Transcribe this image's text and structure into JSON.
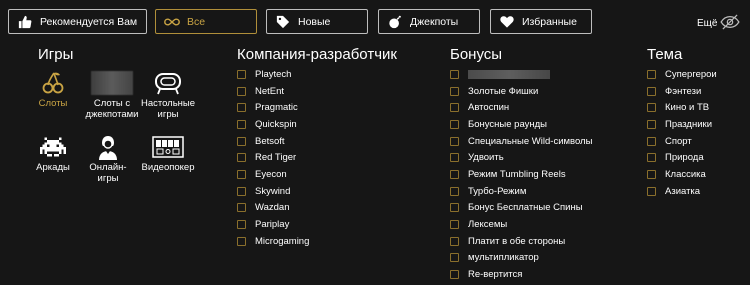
{
  "filters": [
    {
      "label": "Рекомендуется Вам",
      "icon": "thumbs-up-icon",
      "active": false
    },
    {
      "label": "Все",
      "icon": "infinity-icon",
      "active": true
    },
    {
      "label": "Новые",
      "icon": "tag-icon",
      "active": false
    },
    {
      "label": "Джекпоты",
      "icon": "bomb-icon",
      "active": false
    },
    {
      "label": "Избранные",
      "icon": "heart-icon",
      "active": false
    }
  ],
  "more": {
    "label": "Ещё",
    "icon": "eye-slash-icon"
  },
  "games": {
    "title": "Игры",
    "types": [
      {
        "label": "Слоты",
        "icon": "cherries-icon",
        "selected": true
      },
      {
        "label": "Слоты с джекпотами",
        "icon": "blurred-image",
        "selected": false
      },
      {
        "label": "Настольные игры",
        "icon": "table-icon",
        "selected": false
      },
      {
        "label": "Аркады",
        "icon": "space-invader-icon",
        "selected": false
      },
      {
        "label": "Онлайн-игры",
        "icon": "dealer-icon",
        "selected": false
      },
      {
        "label": "Видеопокер",
        "icon": "cards-icon",
        "selected": false
      }
    ]
  },
  "providers": {
    "title": "Компания-разработчик",
    "items": [
      "Playtech",
      "NetEnt",
      "Pragmatic",
      "Quickspin",
      "Betsoft",
      "Red Tiger",
      "Eyecon",
      "Skywind",
      "Wazdan",
      "Pariplay",
      "Microgaming"
    ]
  },
  "bonuses": {
    "title": "Бонусы",
    "items": [
      "",
      "Золотые Фишки",
      "Автоспин",
      "Бонусные раунды",
      "Специальные Wild-символы",
      "Удвоить",
      "Режим Tumbling Reels",
      "Турбо-Режим",
      "Бонус Бесплатные Спины",
      "Лексемы",
      "Платит в обе стороны",
      "мультипликатор",
      "Re-вертится"
    ]
  },
  "themes": {
    "title": "Тема",
    "items": [
      "Супергерои",
      "Фэнтези",
      "Кино и ТВ",
      "Праздники",
      "Спорт",
      "Природа",
      "Классика",
      "Азиатка"
    ]
  },
  "colors": {
    "background": "#161616",
    "accent": "#c9a444",
    "checkbox_border": "#8a6f2c"
  }
}
